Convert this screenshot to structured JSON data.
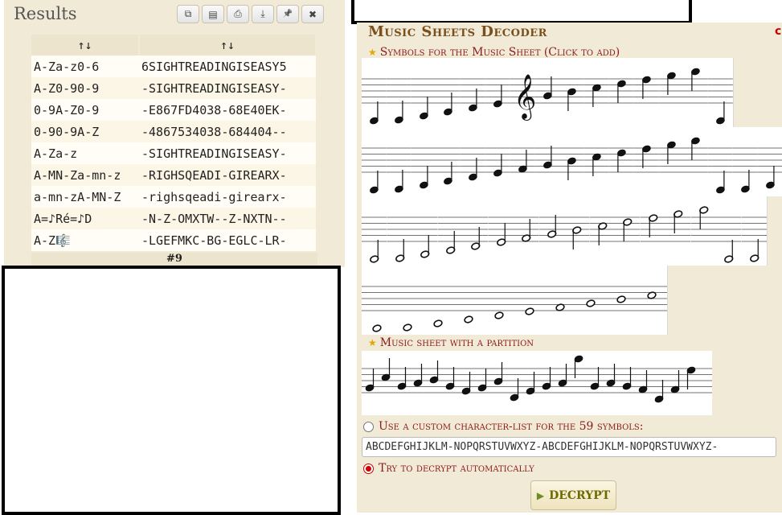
{
  "results": {
    "title": "Results",
    "toolbar": [
      {
        "name": "copy-icon",
        "glyph": "⧉"
      },
      {
        "name": "scroll-icon",
        "glyph": "▤"
      },
      {
        "name": "print-icon",
        "glyph": "⎙"
      },
      {
        "name": "download-icon",
        "glyph": "⤓"
      },
      {
        "name": "pin-icon",
        "glyph": "📌"
      },
      {
        "name": "close-icon",
        "glyph": "✖"
      }
    ],
    "headers": [
      "↑↓",
      "↑↓"
    ],
    "rows": [
      [
        "A-Za-z0-6",
        "6SIGHTREADINGISEASY5"
      ],
      [
        "A-Z0-90-9",
        "-SIGHTREADINGISEASY-"
      ],
      [
        "0-9A-Z0-9",
        "-E867FD4038-68E40EK-"
      ],
      [
        "0-90-9A-Z",
        "-4867534038-684404--"
      ],
      [
        "A-Za-z",
        "-SIGHTREADINGISEASY-"
      ],
      [
        "A-MN-Za-mn-z",
        "-RIGHSQEADI-GIREARX-"
      ],
      [
        "a-mn-zA-MN-Z",
        "-righsqeadi-girearx-"
      ],
      [
        "A=♪Ré=♪D",
        "-N-Z-OMXTW--Z-NXTN--"
      ],
      [
        "A-Z🎼",
        "-LGEFMKC-BG-EGLC-LR-"
      ]
    ],
    "footer": "#9"
  },
  "tool": {
    "title": "Music Sheets Decoder",
    "symbols_label": "Symbols for the Music Sheet (Click to add)",
    "partition_label": "Music sheet with a partition",
    "custom_option": "Use a custom character-list for the 59 symbols:",
    "charlist_value": "ABCDEFGHIJKLM-NOPQRSTUVWXYZ-ABCDEFGHIJKLM-NOPQRSTUVWXYZ-",
    "auto_option": "Try to decrypt automatically",
    "decrypt_label": "DECRYPT"
  }
}
